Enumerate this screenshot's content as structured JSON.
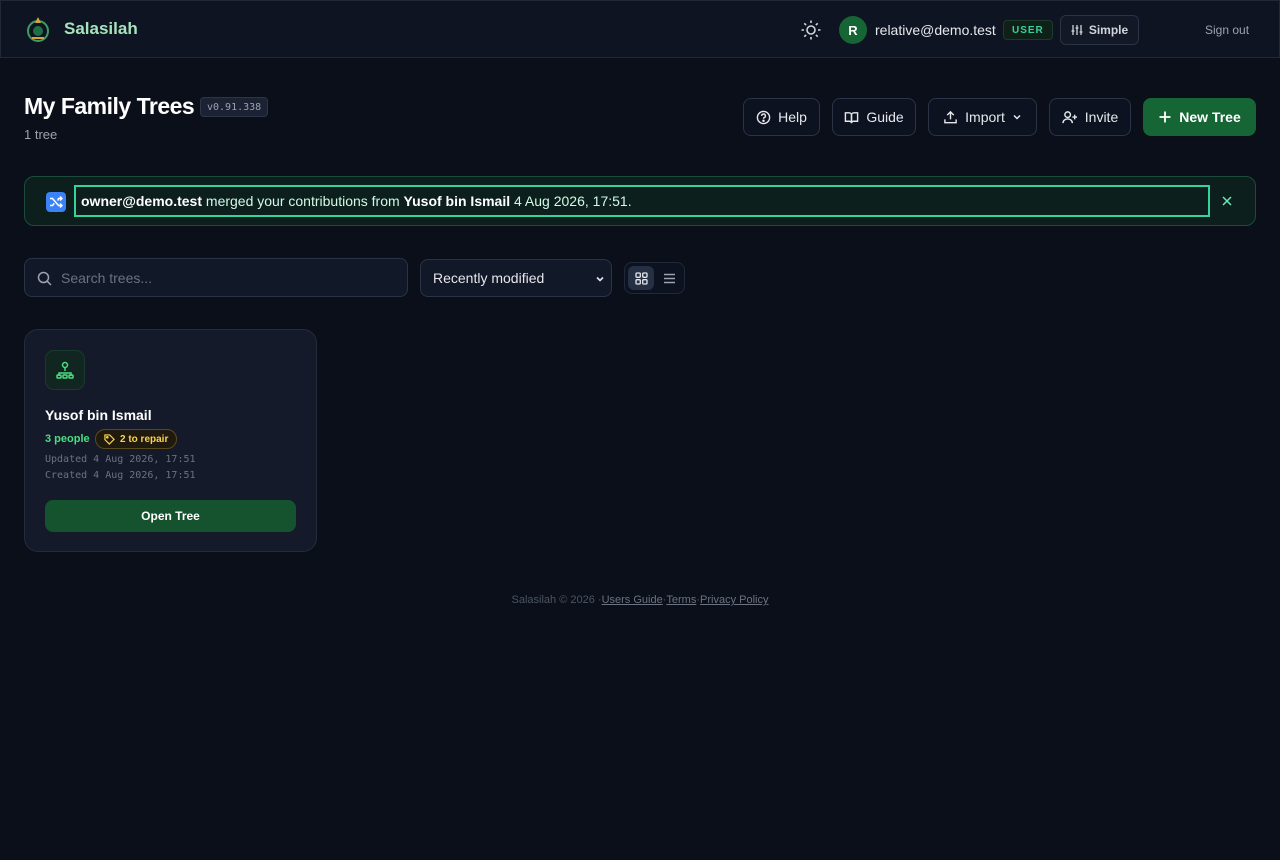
{
  "header": {
    "brand": "Salasilah",
    "user_initial": "R",
    "user_email": "relative@demo.test",
    "role": "USER",
    "mode_label": "Simple",
    "signout": "Sign out"
  },
  "page": {
    "title": "My Family Trees",
    "version": "v0.91.338",
    "tree_count": "1 tree"
  },
  "toolbar": {
    "help": "Help",
    "guide": "Guide",
    "import": "Import",
    "invite": "Invite",
    "new_tree": "New Tree"
  },
  "notice": {
    "actor": "owner@demo.test",
    "message": " merged your contributions from ",
    "tree": "Yusof bin Ismail",
    "time": " 4 Aug 2026, 17:51."
  },
  "filters": {
    "search_placeholder": "Search trees...",
    "sort_selected": "Recently modified"
  },
  "trees": [
    {
      "name": "Yusof bin Ismail",
      "people": "3 people",
      "repair": "2 to repair",
      "updated": "Updated 4 Aug 2026, 17:51",
      "created": "Created 4 Aug 2026, 17:51",
      "open_label": "Open Tree"
    }
  ],
  "footer": {
    "copyright": "Salasilah © 2026",
    "sep": "·",
    "guide": "Users Guide",
    "terms": "Terms",
    "privacy": "Privacy Policy"
  },
  "colors": {
    "accent": "#166534",
    "brand_text": "#a7e3bd",
    "notice_border": "#34d399",
    "repair": "#fcd34d"
  },
  "icons": {
    "logo": "tree-crest-icon",
    "theme": "sun-icon",
    "mode": "sliders-icon",
    "help": "help-circle-icon",
    "guide": "book-icon",
    "import": "upload-icon",
    "invite": "user-plus-icon",
    "new_tree": "plus-icon",
    "notice": "shuffle-icon",
    "close": "close-icon",
    "search": "search-icon",
    "grid": "grid-icon",
    "list": "list-icon",
    "tree": "family-tree-icon",
    "repair": "tag-icon"
  }
}
